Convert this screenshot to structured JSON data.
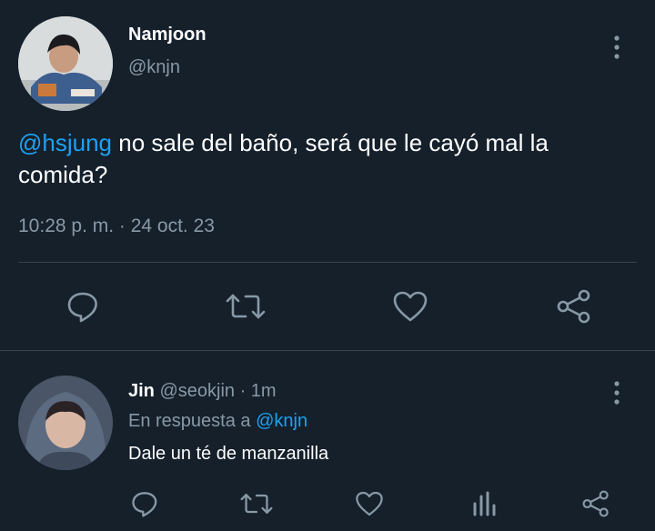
{
  "colors": {
    "background": "#15202b",
    "text": "#ffffff",
    "muted": "#8899a6",
    "link": "#1da1f2",
    "divider": "#38444d"
  },
  "main_tweet": {
    "author_name": "Namjoon",
    "author_handle": "@knjn",
    "mention": "@hsjung",
    "text_rest": " no sale del baño, será que le cayó mal la comida?",
    "timestamp": "10:28 p. m. · 24 oct. 23",
    "actions": [
      "comment-icon",
      "retweet-icon",
      "heart-icon",
      "share-icon"
    ]
  },
  "reply": {
    "author_name": "Jin",
    "author_handle": "@seokjin",
    "time": "· 1m",
    "reply_to_prefix": "En respuesta a ",
    "reply_to_handle": "@knjn",
    "text": "Dale un té de manzanilla",
    "actions": [
      "comment-icon",
      "retweet-icon",
      "heart-icon",
      "analytics-icon",
      "share-icon"
    ]
  }
}
